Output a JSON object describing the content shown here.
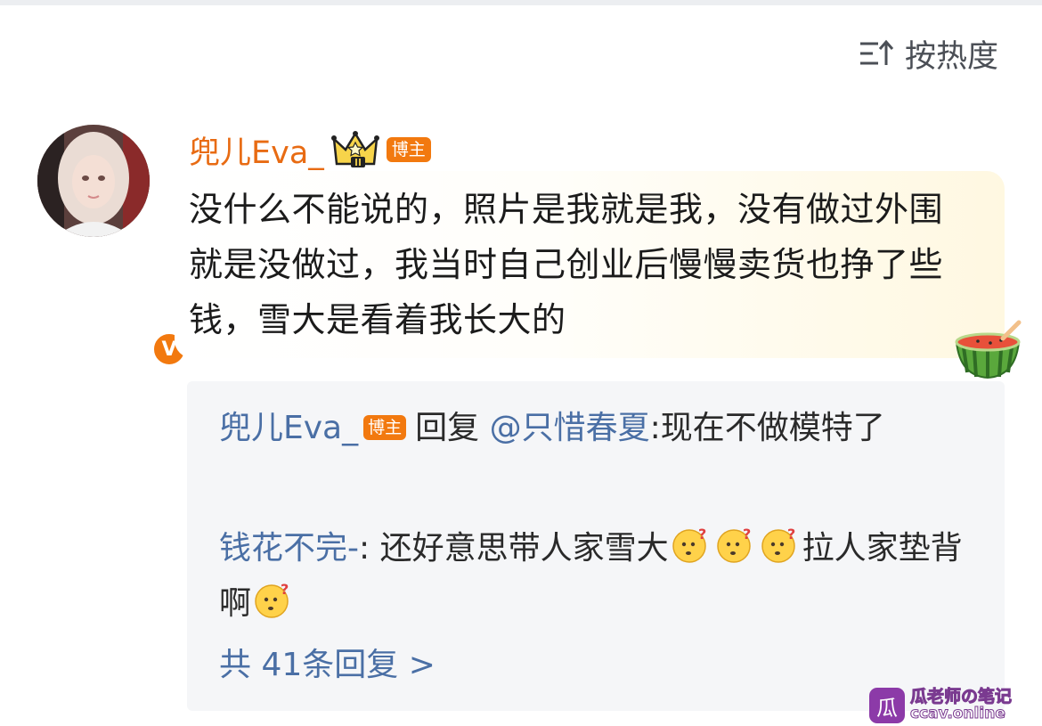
{
  "header": {
    "sort_label": "按热度",
    "sort_icon": "sort-lines-up-arrow-icon"
  },
  "comment": {
    "author": "兜儿Eva_",
    "author_color": "#e86b13",
    "crown_icon": "crown-level-2-icon",
    "author_tag": "博主",
    "verified_icon": "verified-v-badge",
    "verified_badge_text": "V",
    "text": "没什么不能说的，照片是我就是我，没有做过外围就是没做过，我当时自己创业后慢慢卖货也挣了些钱，雪大是看着我长大的",
    "bubble_decoration": "watermelon-bowl-icon"
  },
  "replies": {
    "items": [
      {
        "author": "兜儿Eva_",
        "tag": "博主",
        "reply_prefix": "回复",
        "mention": "@只惜春夏",
        "text": ":现在不做模特了"
      },
      {
        "author": "钱花不完-",
        "text_part1": ": 还好意思带人家雪大",
        "text_part2": "拉人家垫背啊",
        "emoji": "thinking-question-face-icon"
      }
    ],
    "more_label": "共 41条回复 >"
  },
  "watermark": {
    "logo_char": "瓜",
    "main": "瓜老师の笔记",
    "sub": "ccav.online"
  },
  "colors": {
    "accent_orange": "#f2790f",
    "link_blue": "#4a6fa5",
    "reply_bg": "#f5f6f8"
  }
}
